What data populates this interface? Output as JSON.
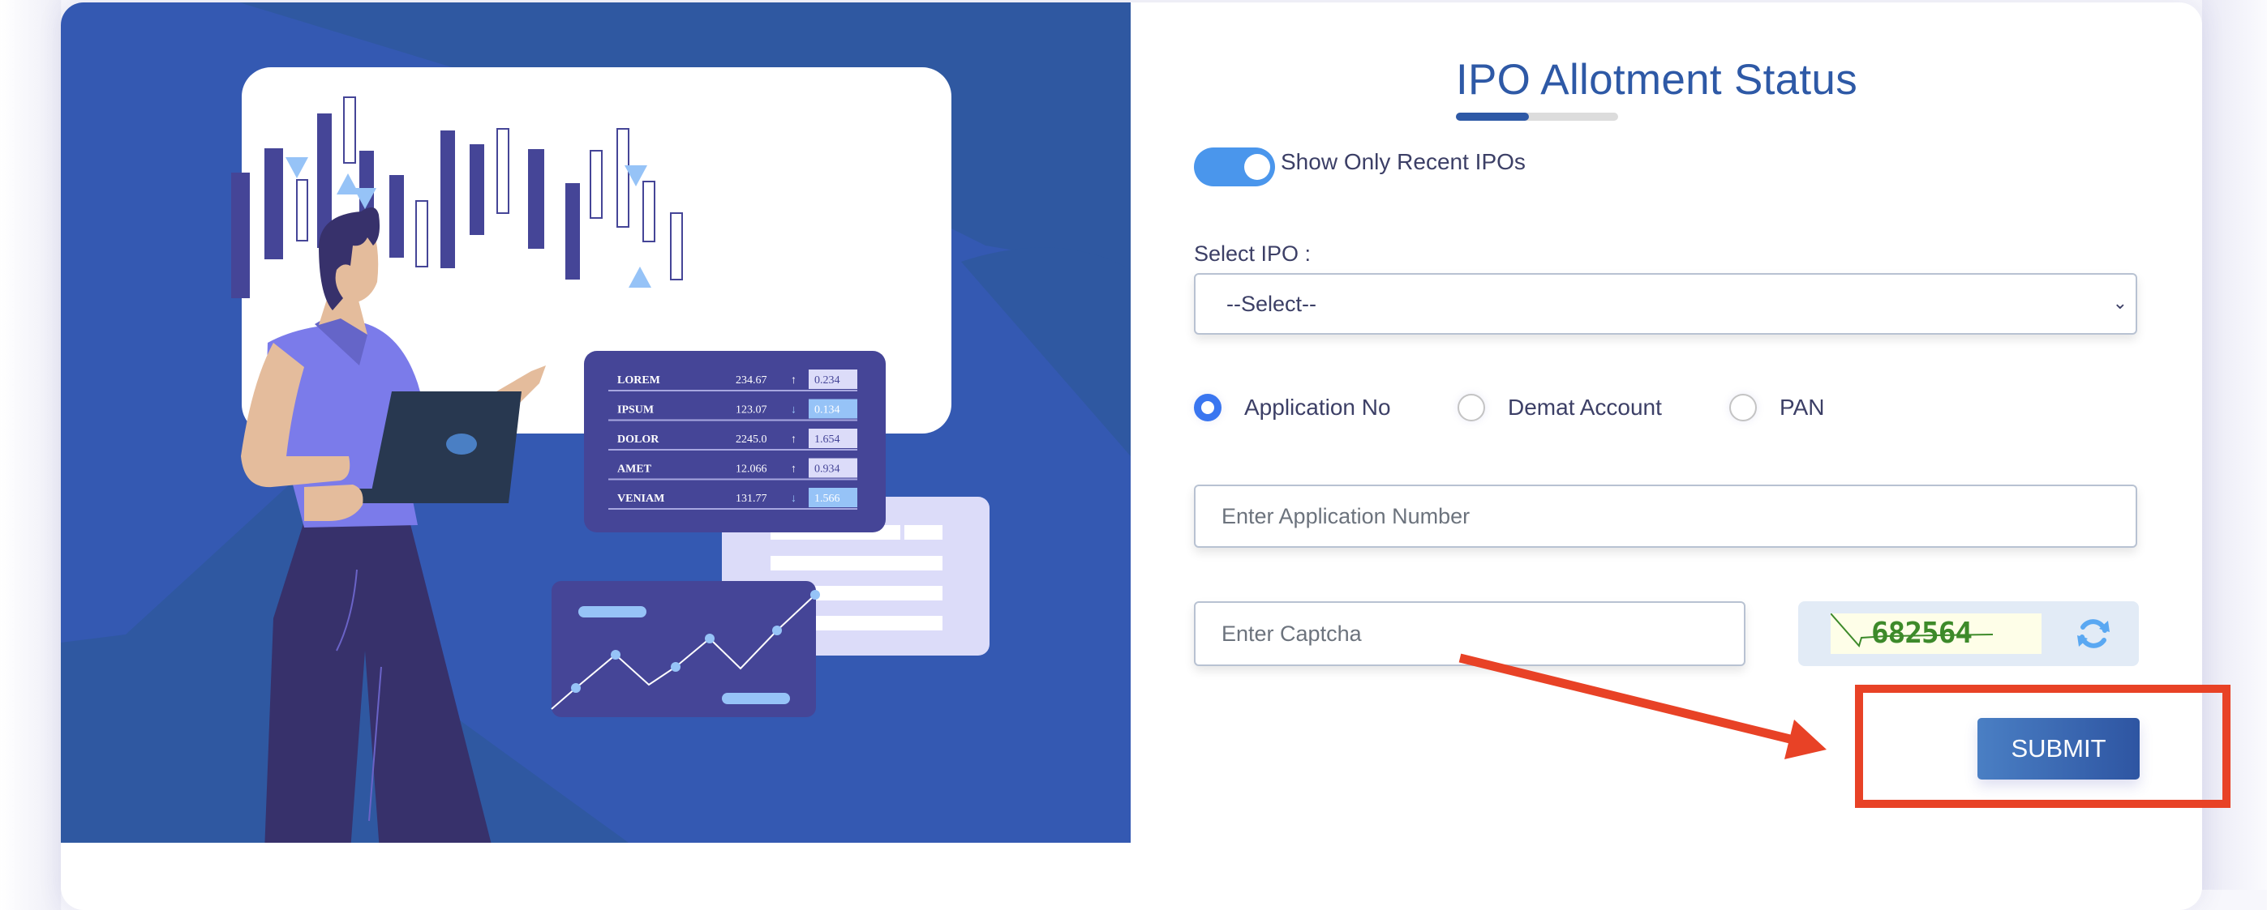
{
  "page": {
    "title": "IPO Allotment Status",
    "title_progress_fraction": 0.45
  },
  "toggle": {
    "label": "Show Only Recent IPOs",
    "checked": true
  },
  "select_ipo": {
    "label": "Select IPO :",
    "selected": "--Select--",
    "chevron_icon": "chevron-down-icon"
  },
  "search_by": {
    "options": [
      {
        "label": "Application No",
        "selected": true
      },
      {
        "label": "Demat Account",
        "selected": false
      },
      {
        "label": "PAN",
        "selected": false
      }
    ]
  },
  "application_input": {
    "placeholder": "Enter Application Number",
    "value": ""
  },
  "captcha": {
    "placeholder": "Enter Captcha",
    "value": "",
    "code": "682564",
    "refresh_icon": "refresh-icon"
  },
  "submit": {
    "label": "SUBMIT"
  },
  "annotation": {
    "color": "#e84226",
    "highlight": "submit-button"
  },
  "illustration": {
    "ticker_table": [
      {
        "name": "LOREM",
        "price": "234.67",
        "direction": "up",
        "change": "0.234"
      },
      {
        "name": "IPSUM",
        "price": "123.07",
        "direction": "down",
        "change": "0.134"
      },
      {
        "name": "DOLOR",
        "price": "2245.0",
        "direction": "up",
        "change": "1.654"
      },
      {
        "name": "AMET",
        "price": "12.066",
        "direction": "up",
        "change": "0.934"
      },
      {
        "name": "VENIAM",
        "price": "131.77",
        "direction": "down",
        "change": "1.566"
      }
    ]
  },
  "colors": {
    "brand_blue": "#2e59a6",
    "hero_bg": "#3459b2",
    "toggle_on": "#4a96ec",
    "radio_on": "#3a76f0",
    "captcha_text": "#3d8a2a"
  }
}
